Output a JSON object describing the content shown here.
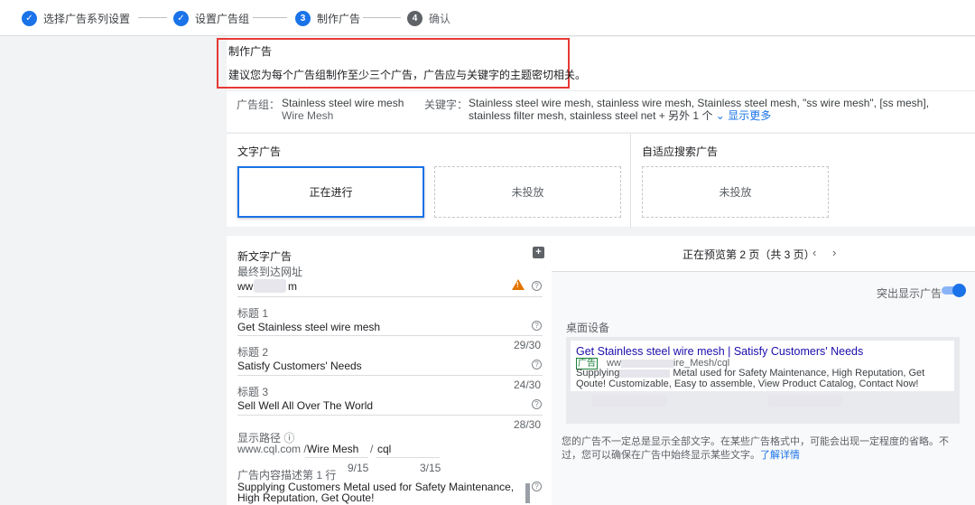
{
  "stepper": {
    "steps": [
      {
        "label": "选择广告系列设置",
        "state": "done"
      },
      {
        "label": "设置广告组",
        "state": "done"
      },
      {
        "label": "制作广告",
        "num": "3",
        "state": "active"
      },
      {
        "label": "确认",
        "num": "4",
        "state": "todo"
      }
    ]
  },
  "header": {
    "title": "制作广告",
    "desc": "建议您为每个广告组制作至少三个广告，广告应与关键字的主题密切相关。"
  },
  "adgroup": {
    "label": "广告组：",
    "name": "Stainless steel wire mesh",
    "subname": "Wire Mesh",
    "kw_label": "关键字：",
    "keywords": "Stainless steel wire mesh, stainless wire mesh, Stainless steel mesh, \"ss wire mesh\", [ss mesh], stainless filter mesh, stainless steel net + 另外 1 个",
    "show_more": "显示更多"
  },
  "adtypes": {
    "text_title": "文字广告",
    "rsa_title": "自适应搜索广告",
    "card_active": "正在进行",
    "card_empty1": "未投放",
    "card_empty2": "未投放"
  },
  "editor": {
    "title": "新文字广告",
    "final_url_label": "最终到达网址",
    "final_url_prefix": "ww",
    "final_url_suffix": "m",
    "h1_label": "标题 1",
    "h1_value": "Get Stainless steel wire mesh",
    "h1_count": "29/30",
    "h2_label": "标题 2",
    "h2_value": "Satisfy Customers' Needs",
    "h2_count": "24/30",
    "h3_label": "标题 3",
    "h3_value": "Sell Well All Over The World",
    "h3_count": "28/30",
    "path_label": "显示路径",
    "path_domain": "www.cql.com /",
    "path1": "Wire Mesh",
    "path_sep": "/",
    "path2": "cql",
    "path1_count": "9/15",
    "path2_count": "3/15",
    "desc_label": "广告内容描述第 1 行",
    "desc_value": "Supplying Customers Metal used for Safety Maintenance, High Reputation, Get Qoute!"
  },
  "preview": {
    "page_text": "正在预览第 2 页（共 3 页）",
    "prev_icon": "chevron-left-icon",
    "next_icon": "chevron-right-icon",
    "toggle_label": "突出显示广告",
    "device": "桌面设备",
    "ad_headline": "Get Stainless steel wire mesh | Satisfy Customers' Needs",
    "ad_badge": "广告",
    "ad_url_start": "ww",
    "ad_url_end": "ire_Mesh/cql",
    "ad_desc_start": "Supplying",
    "ad_desc_rest": "Metal used for Safety Maintenance, High Reputation, Get Qoute! Customizable, Easy to assemble, View Product Catalog, Contact Now!",
    "note": "您的广告不一定总是显示全部文字。在某些广告格式中，可能会出现一定程度的省略。不过，您可以确保在广告中始终显示某些文字。",
    "learn_more": "了解详情"
  },
  "colors": {
    "accent": "#1a73e8",
    "warning": "#e37400",
    "highlight": "#e53935"
  }
}
